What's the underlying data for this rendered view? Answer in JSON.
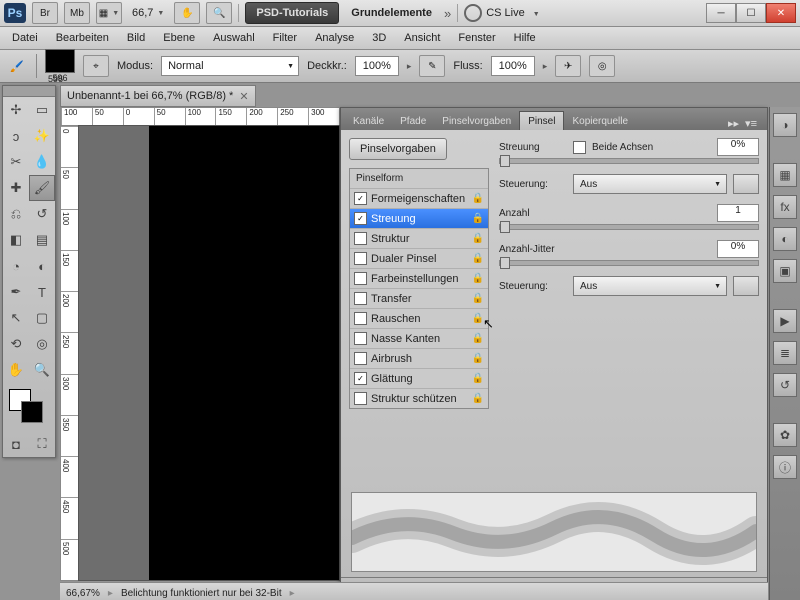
{
  "titlebar": {
    "zoom": "66,7",
    "psd_tutorials": "PSD-Tutorials",
    "grundelemente": "Grundelemente",
    "cslive": "CS Live"
  },
  "menu": {
    "datei": "Datei",
    "bearbeiten": "Bearbeiten",
    "bild": "Bild",
    "ebene": "Ebene",
    "auswahl": "Auswahl",
    "filter": "Filter",
    "analyse": "Analyse",
    "dreid": "3D",
    "ansicht": "Ansicht",
    "fenster": "Fenster",
    "hilfe": "Hilfe"
  },
  "options": {
    "swatch_num": "596",
    "modus": "Modus:",
    "modus_val": "Normal",
    "deckkr": "Deckkr.:",
    "deckkr_val": "100%",
    "fluss": "Fluss:",
    "fluss_val": "100%"
  },
  "doc": {
    "tab": "Unbenannt-1 bei 66,7% (RGB/8) *"
  },
  "ruler_h": [
    "100",
    "50",
    "0",
    "50",
    "100",
    "150",
    "200",
    "250",
    "300"
  ],
  "ruler_v": [
    "0",
    "50",
    "100",
    "150",
    "200",
    "250",
    "300",
    "350",
    "400",
    "450",
    "500"
  ],
  "panel": {
    "tabs": {
      "kanaele": "Kanäle",
      "pfade": "Pfade",
      "pinselvorgaben": "Pinselvorgaben",
      "pinsel": "Pinsel",
      "kopierquelle": "Kopierquelle"
    },
    "btn_pinselvorgaben": "Pinselvorgaben",
    "box_title": "Pinselform",
    "items": {
      "formeigenschaften": "Formeigenschaften",
      "streuung": "Streuung",
      "struktur": "Struktur",
      "dualer_pinsel": "Dualer Pinsel",
      "farbeinstellungen": "Farbeinstellungen",
      "transfer": "Transfer",
      "rauschen": "Rauschen",
      "nasse_kanten": "Nasse Kanten",
      "airbrush": "Airbrush",
      "glaettung": "Glättung",
      "struktur_schuetzen": "Struktur schützen"
    },
    "right": {
      "streuung": "Streuung",
      "beide_achsen": "Beide Achsen",
      "streuung_val": "0%",
      "steuerung": "Steuerung:",
      "steuerung_val": "Aus",
      "anzahl": "Anzahl",
      "anzahl_val": "1",
      "anzahl_jitter": "Anzahl-Jitter",
      "anzahl_jitter_val": "0%"
    }
  },
  "status": {
    "zoom": "66,67%",
    "msg": "Belichtung funktioniert nur bei 32-Bit"
  }
}
